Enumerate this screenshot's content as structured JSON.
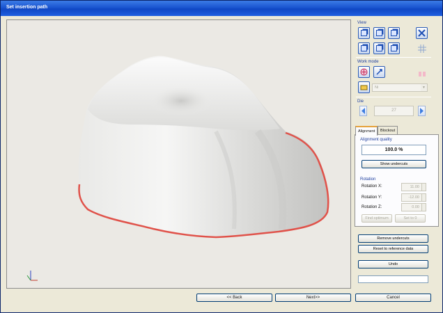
{
  "window": {
    "title": "Set insertion path"
  },
  "panel": {
    "view_label": "View",
    "workmode_label": "Work mode",
    "workmode_combo": "Ni",
    "die_label": "Die",
    "die_value": "27"
  },
  "tabs": [
    {
      "label": "Alignment",
      "active": true
    },
    {
      "label": "Blockout",
      "active": false
    }
  ],
  "alignment": {
    "quality_label": "Alignment quality",
    "quality_value": "100.0 %",
    "show_undercuts": "Show undercuts",
    "rotation_label": "Rotation",
    "rotation_x_label": "Rotation X:",
    "rotation_x_value": "11.00",
    "rotation_y_label": "Rotation Y:",
    "rotation_y_value": "-12.00",
    "rotation_z_label": "Rotation Z:",
    "rotation_z_value": "0.00",
    "find_optimum": "Find optimum",
    "set_to_zero": "Set to 0"
  },
  "actions": {
    "remove_undercuts": "Remove undercuts",
    "reset_reference": "Reset to reference data",
    "undo": "Undo"
  },
  "footer": {
    "back": "<< Back",
    "next": "Next>>",
    "cancel": "Cancel"
  },
  "colors": {
    "margin_line": "#e0524a",
    "accent": "#1d4fb4",
    "background": "#ebe9e4"
  },
  "icons": [
    "view-front-icon",
    "view-side-icon",
    "view-top-icon",
    "fit-view-icon",
    "grid-icon",
    "work-mode-icon",
    "color-tool-icon",
    "prev-arrow-icon",
    "next-arrow-icon",
    "axis-gizmo-icon"
  ]
}
